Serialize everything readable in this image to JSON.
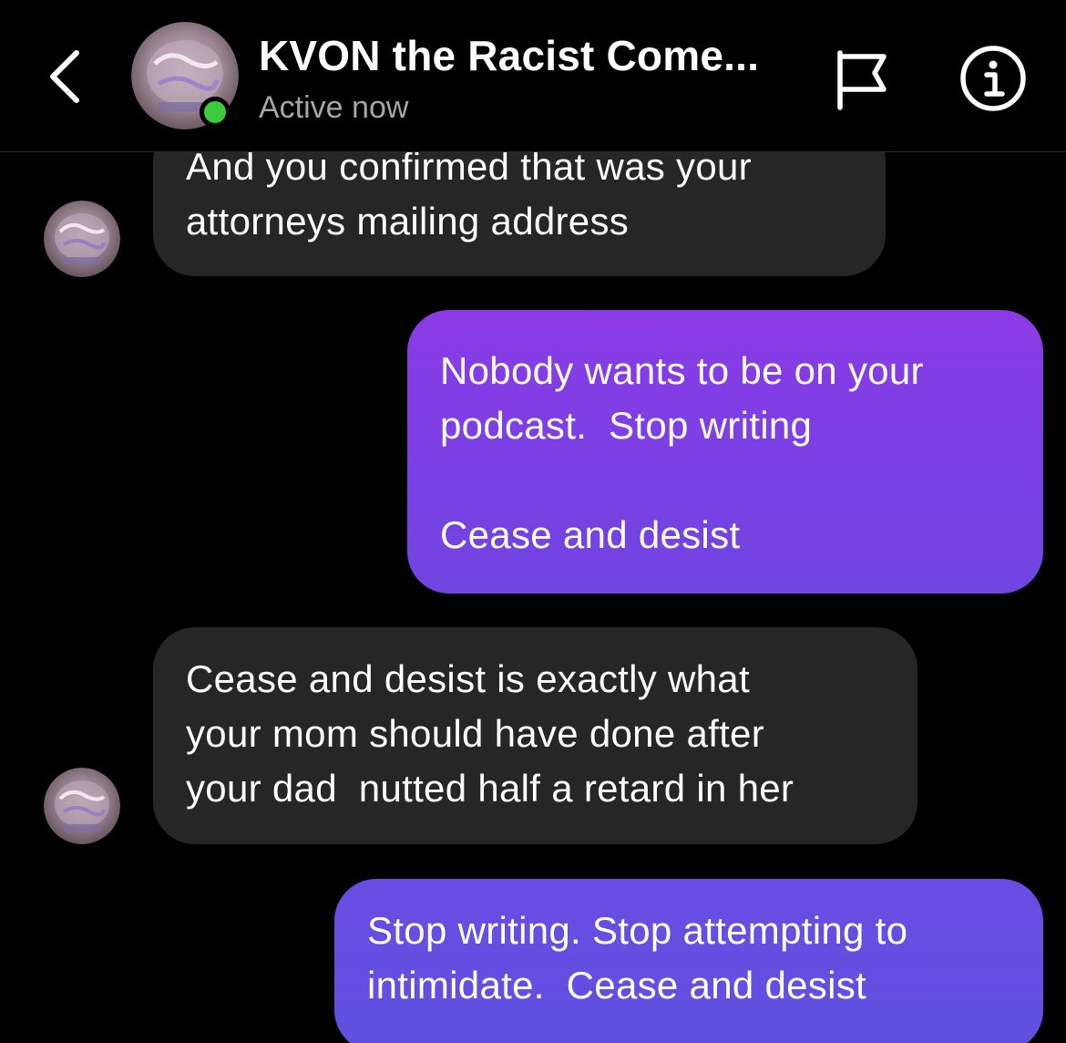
{
  "header": {
    "title": "KVON the Racist Come...",
    "status": "Active now"
  },
  "messages": [
    {
      "direction": "incoming",
      "text": "And you confirmed that was your\nattorneys mailing address"
    },
    {
      "direction": "outgoing",
      "text": "Nobody wants to be on your\npodcast.  Stop writing\n\nCease and desist"
    },
    {
      "direction": "incoming",
      "text": "Cease and desist is exactly what\nyour mom should have done after\nyour dad  nutted half a retard in her"
    },
    {
      "direction": "outgoing",
      "text": "Stop writing. Stop attempting to\nintimidate.  Cease and desist"
    }
  ],
  "icons": {
    "back": "chevron-left-icon",
    "flag": "flag-icon",
    "info": "info-icon",
    "online": "online-status-dot"
  },
  "colors": {
    "incoming_bubble": "#262626",
    "outgoing_bubble_top": "#8b3be6",
    "outgoing_bubble_bottom": "#5e51e0",
    "online": "#3ccb3c",
    "background": "#000000"
  }
}
